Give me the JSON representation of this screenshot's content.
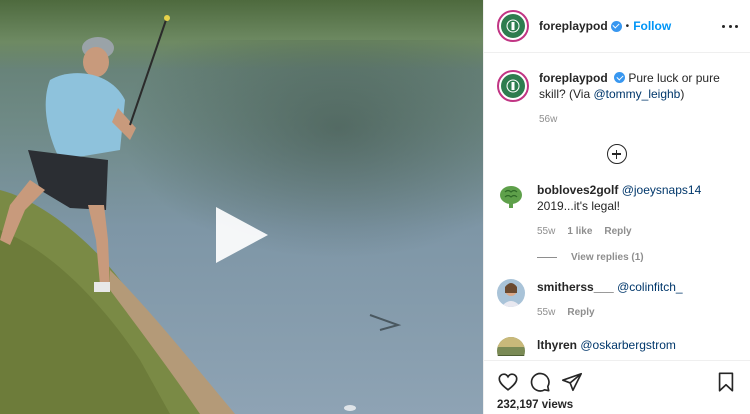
{
  "post": {
    "username": "foreplaypod",
    "follow_label": "Follow",
    "dot": "•",
    "caption_text": "Pure luck or pure skill? (Via ",
    "caption_mention": "@tommy_leighb",
    "caption_end": ")",
    "caption_time": "56w"
  },
  "comments": [
    {
      "username": "bobloves2golf",
      "mention": "@joeysnaps14",
      "text": "2019...it's legal!",
      "time": "55w",
      "likes": "1 like",
      "reply": "Reply",
      "view_replies": "View replies (1)"
    },
    {
      "username": "smitherss___",
      "mention": "@colinfitch_",
      "text": "",
      "time": "55w",
      "reply": "Reply"
    },
    {
      "username": "lthyren",
      "mention": "@oskarbergstrom",
      "text": ""
    }
  ],
  "stats": {
    "views_count": "232,197",
    "views_label": "views"
  },
  "icons": {
    "play": "play-icon",
    "more": "more-icon",
    "add": "plus-icon",
    "like": "heart-icon",
    "comment": "comment-icon",
    "share": "share-icon",
    "save": "bookmark-icon"
  },
  "colors": {
    "accent": "#0095f6",
    "verified": "#3897f0",
    "muted": "#8e8e8e"
  }
}
